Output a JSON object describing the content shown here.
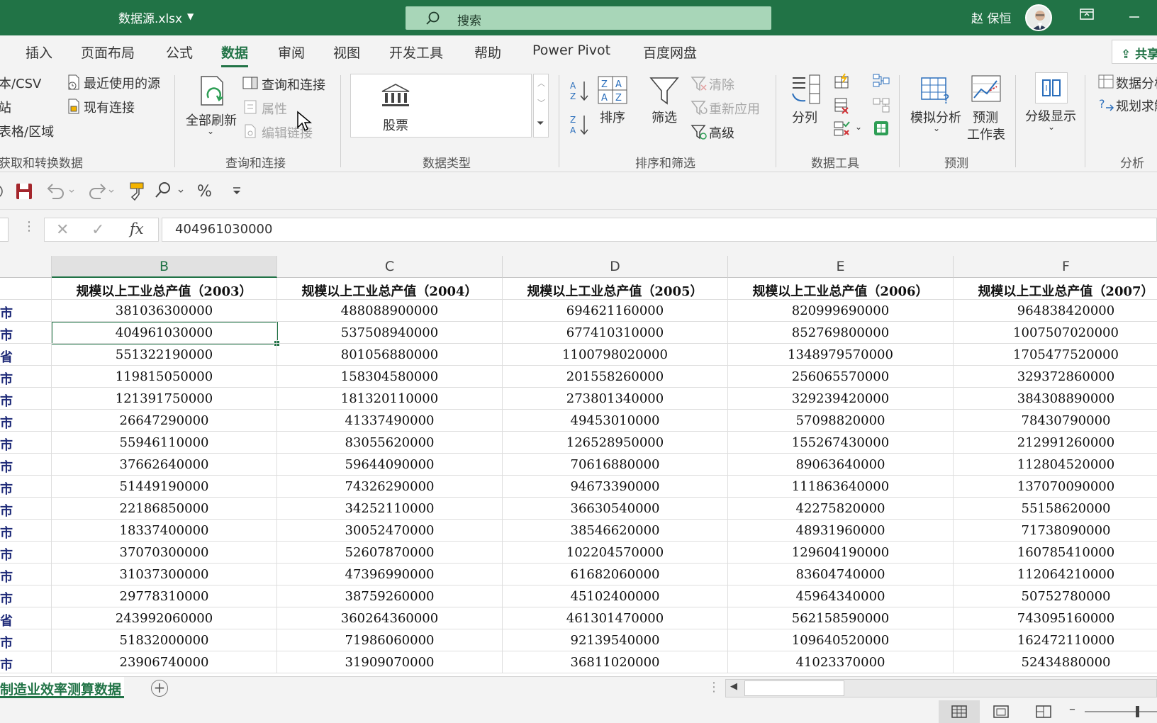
{
  "titlebar": {
    "filename": "数据源.xlsx",
    "search_placeholder": "搜索",
    "user_name": "赵 保恒"
  },
  "tabs": [
    "插入",
    "页面布局",
    "公式",
    "数据",
    "审阅",
    "视图",
    "开发工具",
    "帮助",
    "Power Pivot",
    "百度网盘"
  ],
  "active_tab": "数据",
  "share_label": "共享",
  "ribbon": {
    "get_data": {
      "text_csv": "本/CSV",
      "web": "站",
      "table_range": "表格/区域",
      "recent_sources": "最近使用的源",
      "existing_connections": "现有连接",
      "group": "获取和转换数据"
    },
    "queries": {
      "refresh_all": "全部刷新",
      "queries_connections": "查询和连接",
      "properties": "属性",
      "edit_links": "编辑链接",
      "group": "查询和连接"
    },
    "data_types": {
      "stocks": "股票",
      "group": "数据类型"
    },
    "sort_filter": {
      "sort": "排序",
      "filter": "筛选",
      "clear": "清除",
      "reapply": "重新应用",
      "advanced": "高级",
      "group": "排序和筛选"
    },
    "data_tools": {
      "text_to_columns": "分列",
      "group": "数据工具"
    },
    "forecast": {
      "what_if": "模拟分析",
      "forecast_sheet_1": "预测",
      "forecast_sheet_2": "工作表",
      "group": "预测"
    },
    "outline": {
      "label": "分级显示"
    },
    "analysis": {
      "data_analysis": "数据分析",
      "solver": "规划求解",
      "group": "分析"
    }
  },
  "formula_bar": {
    "value": "404961030000"
  },
  "columns": [
    "B",
    "C",
    "D",
    "E",
    "F"
  ],
  "header_row": [
    "规模以上工业总产值（2003）",
    "规模以上工业总产值（2004）",
    "规模以上工业总产值（2005）",
    "规模以上工业总产值（2006）",
    "规模以上工业总产值（2007）"
  ],
  "rows": [
    {
      "a": "市",
      "v": [
        "381036300000",
        "488088900000",
        "694621160000",
        "820999690000",
        "964838420000"
      ]
    },
    {
      "a": "市",
      "v": [
        "404961030000",
        "537508940000",
        "677410310000",
        "852769800000",
        "1007507020000"
      ]
    },
    {
      "a": "省",
      "v": [
        "551322190000",
        "801056880000",
        "1100798020000",
        "1348979570000",
        "1705477520000"
      ]
    },
    {
      "a": "市",
      "v": [
        "119815050000",
        "158304580000",
        "201558260000",
        "256065570000",
        "329372860000"
      ]
    },
    {
      "a": "市",
      "v": [
        "121391750000",
        "181320110000",
        "273801340000",
        "329239420000",
        "384308890000"
      ]
    },
    {
      "a": "市",
      "v": [
        "26647290000",
        "41337490000",
        "49453010000",
        "57098820000",
        "78430790000"
      ]
    },
    {
      "a": "市",
      "v": [
        "55946110000",
        "83055620000",
        "126528950000",
        "155267430000",
        "212991260000"
      ]
    },
    {
      "a": "市",
      "v": [
        "37662640000",
        "59644090000",
        "70616880000",
        "89063640000",
        "112804520000"
      ]
    },
    {
      "a": "市",
      "v": [
        "51449190000",
        "74326290000",
        "94673390000",
        "111863640000",
        "137070090000"
      ]
    },
    {
      "a": "市",
      "v": [
        "22186850000",
        "34252110000",
        "36630540000",
        "42275820000",
        "55158620000"
      ]
    },
    {
      "a": "市",
      "v": [
        "18337400000",
        "30052470000",
        "38546620000",
        "48931960000",
        "71738090000"
      ]
    },
    {
      "a": "市",
      "v": [
        "37070300000",
        "52607870000",
        "102204570000",
        "129604190000",
        "160785410000"
      ]
    },
    {
      "a": "市",
      "v": [
        "31037300000",
        "47396990000",
        "61682060000",
        "83604740000",
        "112064210000"
      ]
    },
    {
      "a": "市",
      "v": [
        "29778310000",
        "38759260000",
        "45102400000",
        "45964340000",
        "50752780000"
      ]
    },
    {
      "a": "省",
      "v": [
        "243992060000",
        "360264360000",
        "461301470000",
        "562158590000",
        "743095160000"
      ]
    },
    {
      "a": "市",
      "v": [
        "51832000000",
        "71986060000",
        "92139540000",
        "109640520000",
        "162472110000"
      ]
    },
    {
      "a": "市",
      "v": [
        "23906740000",
        "31909070000",
        "36811020000",
        "41023370000",
        "52434880000"
      ]
    }
  ],
  "sheet_tab": "制造业效率测算数据"
}
